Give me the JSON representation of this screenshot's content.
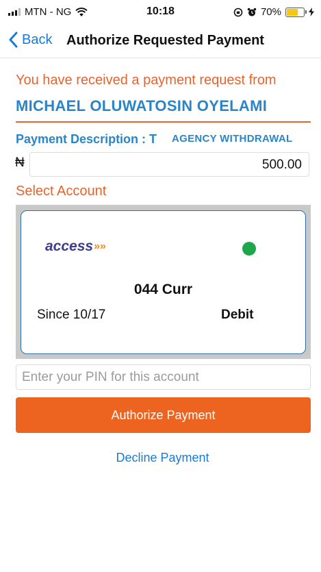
{
  "status_bar": {
    "carrier": "MTN - NG",
    "time": "10:18",
    "battery_percent": "70%",
    "battery_level": 0.7,
    "battery_color": "#f5c518"
  },
  "nav": {
    "back_label": "Back",
    "title": "Authorize Requested Payment"
  },
  "request": {
    "intro": "You have received a payment request from",
    "payer_name": "MICHAEL OLUWATOSIN OYELAMI",
    "description_label": "Payment Description : T",
    "description_value": "AGENCY WITHDRAWAL",
    "currency_symbol": "₦",
    "amount": "500.00"
  },
  "account": {
    "section_label": "Select Account",
    "bank_logo_text": "access",
    "bank_logo_mark": "»»",
    "status_color": "#1ea64a",
    "account_number": "044 Curr",
    "since": "Since 10/17",
    "type": "Debit"
  },
  "pin": {
    "placeholder": "Enter your PIN for this account"
  },
  "actions": {
    "authorize_label": "Authorize Payment",
    "decline_label": "Decline Payment"
  },
  "colors": {
    "accent_orange": "#ec6420",
    "link_blue": "#1a7ad8",
    "heading_blue": "#2a85c8"
  }
}
